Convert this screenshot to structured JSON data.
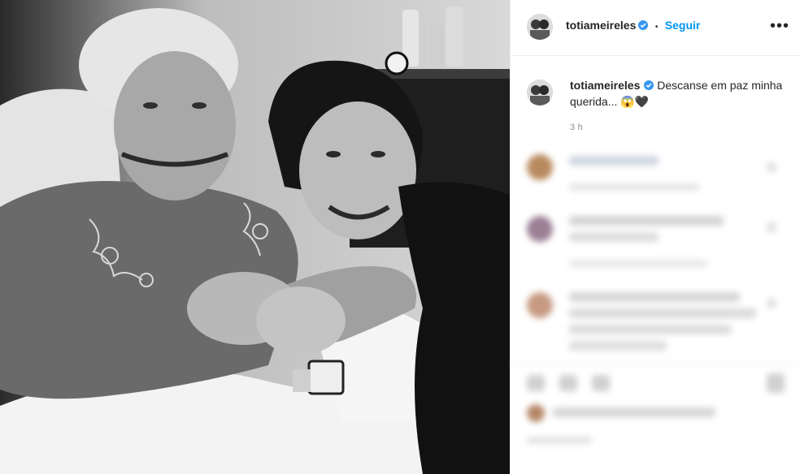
{
  "post": {
    "photo_icon": "photo",
    "author": {
      "username": "totiameireles",
      "verified": true,
      "avatar_icon": "avatar"
    },
    "header": {
      "separator": "•",
      "follow_label": "Seguir",
      "more_icon": "more-options-icon",
      "more_glyph": "•••"
    },
    "caption": {
      "text": "Descanse em paz minha querida... 😱🖤",
      "timestamp": "3 h"
    }
  },
  "colors": {
    "accent": "#0095f6",
    "verified": "#3897f0",
    "text": "#262626",
    "muted": "#8e8e8e"
  }
}
